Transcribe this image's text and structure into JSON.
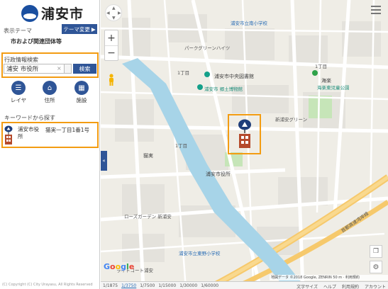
{
  "app": {
    "logo_text": "浦安市"
  },
  "theme": {
    "label": "表示テーマ",
    "change_button": "テーマ変更",
    "current": "市および関連団体等"
  },
  "admin_search": {
    "title": "行政情報検索",
    "input_value": "浦安 市役所",
    "button": "検索"
  },
  "tools": [
    {
      "label": "レイヤ",
      "icon": "list-icon"
    },
    {
      "label": "住所",
      "icon": "home-icon"
    },
    {
      "label": "施設",
      "icon": "building-icon"
    }
  ],
  "keyword": {
    "title": "キーワードから探す",
    "result_name": "浦安市役所",
    "result_address": "猫実一丁目1番1号"
  },
  "copyright": "(C) Copyright (C) City Urayasu, All Rights Reserved",
  "map": {
    "labels": {
      "school_north": "浦安市立南小学校",
      "library": "浦安市中央図書館",
      "museum": "浦安市 郷土博物館",
      "cityhall": "浦安市役所",
      "kaiyo_park": "海楽東児童公園",
      "higashino_school": "浦安市立東野小学校",
      "chome1_a": "1丁目",
      "chome1_b": "1丁目",
      "chome1_c": "1丁目",
      "kaiyo": "海楽",
      "nekozane": "猫実",
      "shuto": "首都高速湾岸線",
      "park_green": "パークグリーンハイツ",
      "shin_urayasu": "新浦安グリーン",
      "rose_garden": "ローズガーデン 新浦安",
      "light_court": "ライトコート浦安"
    },
    "google": "Google",
    "footer": "地図データ ©2018 Google, ZENRIN  50 m",
    "footer_links": [
      "利用規約"
    ],
    "scale_options": [
      "1/1875",
      "1/3750",
      "1/7500",
      "1/15000",
      "1/30000",
      "1/60000"
    ],
    "scale_selected": "1/3750",
    "bottom_links": [
      "文字サイズ",
      "ヘルプ",
      "利用規約",
      "アカウント"
    ]
  }
}
